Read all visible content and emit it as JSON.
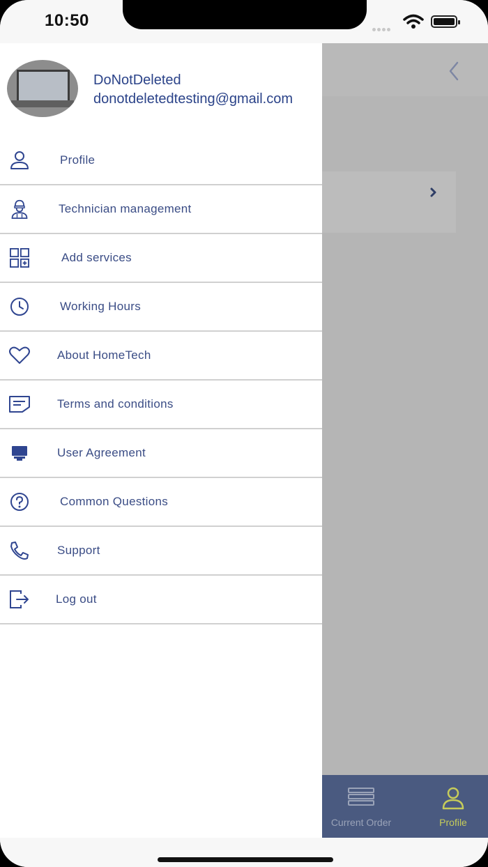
{
  "status": {
    "time": "10:50"
  },
  "user": {
    "name": "DoNotDeleted",
    "email": "donotdeletedtesting@gmail.com"
  },
  "menu": [
    {
      "label": "Profile",
      "icon": "person-icon"
    },
    {
      "label": "Technician management",
      "icon": "technician-icon"
    },
    {
      "label": "Add services",
      "icon": "grid-add-icon"
    },
    {
      "label": "Working Hours",
      "icon": "clock-icon"
    },
    {
      "label": "About HomeTech",
      "icon": "heart-icon"
    },
    {
      "label": "Terms and conditions",
      "icon": "document-icon"
    },
    {
      "label": "User Agreement",
      "icon": "monitor-icon"
    },
    {
      "label": "Common Questions",
      "icon": "question-icon"
    },
    {
      "label": "Support",
      "icon": "phone-icon"
    },
    {
      "label": "Log out",
      "icon": "logout-icon"
    }
  ],
  "tabs": [
    {
      "label": "Current Order",
      "icon": "list-icon",
      "active": false
    },
    {
      "label": "Profile",
      "icon": "person-icon",
      "active": true
    }
  ],
  "colors": {
    "accent": "#2b4389",
    "menu_text": "#3a4c85",
    "tabbar_bg": "#4a5a80",
    "tab_active": "#c6cc5a",
    "overlay": "#b5b5b5"
  }
}
